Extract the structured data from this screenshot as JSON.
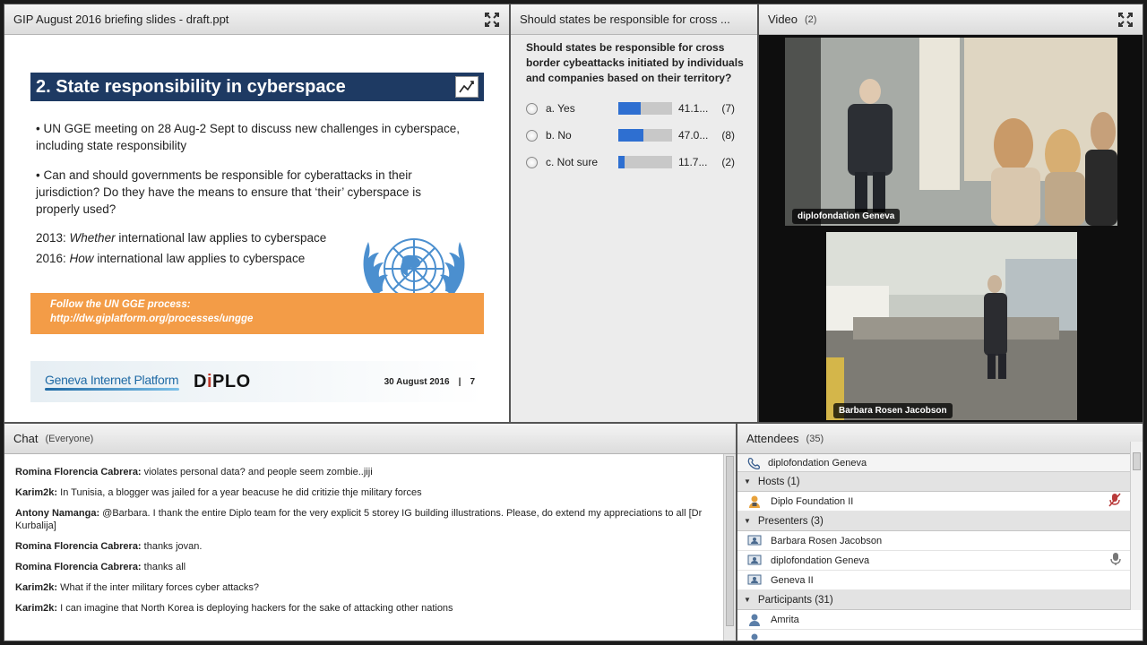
{
  "slides": {
    "title": "GIP August 2016 briefing slides - draft.ppt",
    "slide_title": "2. State responsibility in cyberspace",
    "bullet1": "• UN GGE meeting on 28 Aug-2 Sept to discuss new challenges in cyberspace, including state responsibility",
    "bullet2": "• Can and should governments be responsible for cyberattacks in their jurisdiction? Do they have the means to ensure that ‘their’ cyberspace is properly used?",
    "line2013_year": "2013: ",
    "line2013_em": "Whether",
    "line2013_rest": " international law applies to cyberspace",
    "line2016_year": "2016: ",
    "line2016_em": "How",
    "line2016_rest": " international law applies to cyberspace",
    "banner_line1": "Follow the UN GGE process:",
    "banner_line2": "http://dw.giplatform.org/processes/ungge",
    "footer_org": "Geneva Internet Platform",
    "footer_brand_a": "D",
    "footer_brand_i": "i",
    "footer_brand_b": "PLO",
    "footer_date": "30 August 2016",
    "footer_sep": "|",
    "footer_page": "7"
  },
  "poll": {
    "title": "Should states be responsible for cross ...",
    "question": "Should states be responsible for cross border cybeattacks initiated by individuals and companies based on their territory?",
    "options": [
      {
        "label": "a. Yes",
        "percent_text": "41.1...",
        "votes": "(7)",
        "fraction": 0.411
      },
      {
        "label": "b. No",
        "percent_text": "47.0...",
        "votes": "(8)",
        "fraction": 0.47
      },
      {
        "label": "c. Not sure",
        "percent_text": "11.7...",
        "votes": "(2)",
        "fraction": 0.117
      }
    ]
  },
  "video": {
    "title": "Video",
    "count": "(2)",
    "feeds": [
      {
        "label": "diplofondation Geneva"
      },
      {
        "label": "Barbara Rosen Jacobson"
      }
    ]
  },
  "chat": {
    "title": "Chat",
    "scope": "(Everyone)",
    "messages": [
      {
        "sender": "Romina Florencia Cabrera:",
        "text": " violates personal data? and people seem zombie..jiji"
      },
      {
        "sender": "Karim2k:",
        "text": " In Tunisia, a blogger was jailed for a year beacuse he did critizie thje military forces"
      },
      {
        "sender": "Antony Namanga:",
        "text": " @Barbara. I thank the entire Diplo team for the very explicit 5 storey IG building illustrations. Please, do extend my appreciations to all [Dr Kurbalija]"
      },
      {
        "sender": "Romina Florencia Cabrera:",
        "text": " thanks jovan."
      },
      {
        "sender": "Romina Florencia Cabrera:",
        "text": " thanks all"
      },
      {
        "sender": "Karim2k:",
        "text": " What if the inter military forces cyber attacks?"
      },
      {
        "sender": "Karim2k:",
        "text": " I can imagine that North Korea is deploying hackers for the sake of attacking other nations"
      }
    ]
  },
  "attendees": {
    "title": "Attendees",
    "count": "(35)",
    "me": "diplofondation Geneva",
    "hosts_label": "Hosts (1)",
    "hosts": [
      "Diplo Foundation II"
    ],
    "presenters_label": "Presenters (3)",
    "presenters": [
      "Barbara Rosen Jacobson",
      "diplofondation Geneva",
      "Geneva II"
    ],
    "participants_label": "Participants (31)",
    "participants": [
      "Amrita"
    ]
  },
  "colors": {
    "slide_title_bg": "#1e3a63",
    "banner_bg": "#f39c47",
    "poll_bar_fill": "#2e6fd1",
    "un_blue": "#4b8fcf"
  },
  "icons": {
    "expand": "expand-icon",
    "chart": "chart-icon",
    "radio": "radio-icon",
    "phone": "phone-icon",
    "user": "user-icon",
    "presenter": "presenter-icon",
    "mic": "microphone-icon",
    "mic_off": "microphone-muted-icon"
  }
}
